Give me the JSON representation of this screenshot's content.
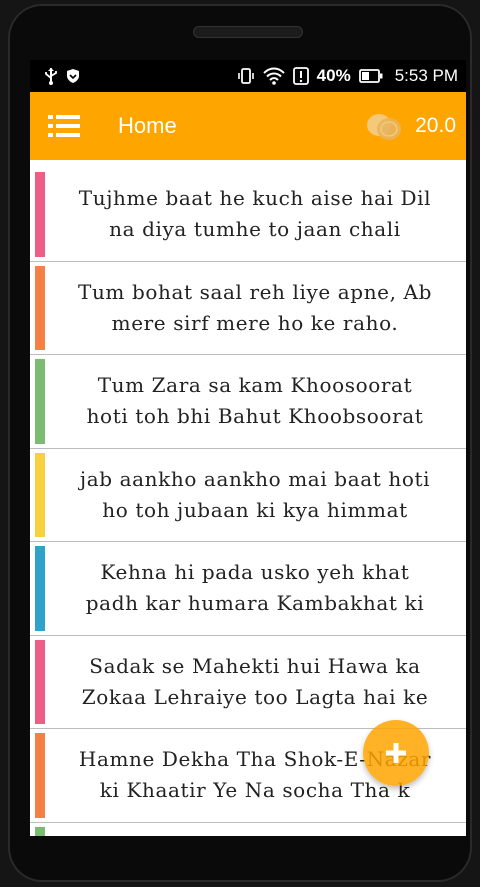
{
  "statusbar": {
    "battery_percent": "40%",
    "time": "5:53 PM"
  },
  "appbar": {
    "title": "Home",
    "coin_count": "20.0"
  },
  "items": [
    {
      "text": "Tujhme baat he kuch aise hai Dil\nna diya tumhe to jaan chali",
      "color": "#EC5E86"
    },
    {
      "text": "Tum bohat saal reh liye apne, Ab\nmere sirf mere ho ke raho.",
      "color": "#F57F45"
    },
    {
      "text": "Tum Zara sa kam Khoosoorat\nhoti toh bhi Bahut Khoobsoorat",
      "color": "#7CBB72"
    },
    {
      "text": "jab aankho aankho mai baat hoti\nho toh jubaan ki kya himmat",
      "color": "#F7D23E"
    },
    {
      "text": "Kehna hi pada usko yeh khat\npadh kar humara Kambakhat ki",
      "color": "#2EA2C8"
    },
    {
      "text": "Sadak se Mahekti hui Hawa ka\nZokaa Lehraiye too Lagta hai ke",
      "color": "#EC5E86"
    },
    {
      "text": "Hamne Dekha Tha Shok-E-Nazar\nki Khaatir Ye Na socha Tha k",
      "color": "#F57F45"
    }
  ],
  "partial_item_color": "#7CBB72",
  "accent": "#FFA500"
}
